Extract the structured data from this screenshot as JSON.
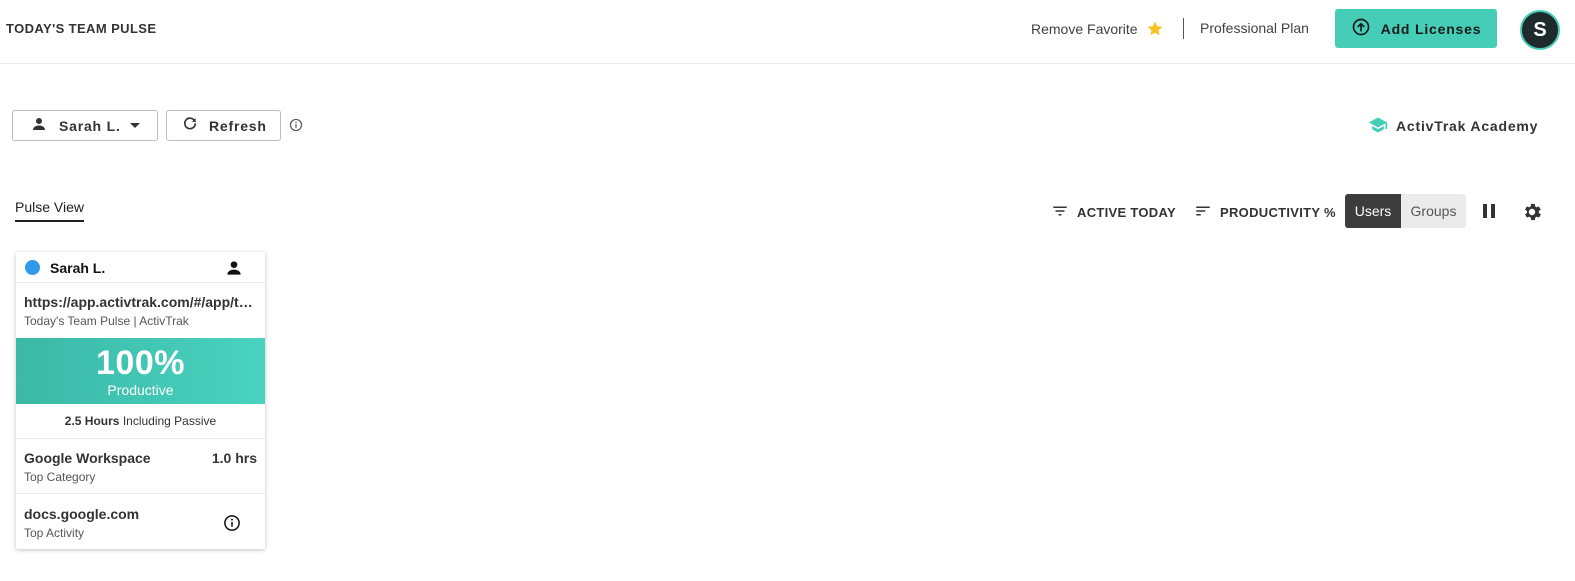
{
  "header": {
    "title": "TODAY'S TEAM PULSE",
    "favorite_label": "Remove Favorite",
    "plan_label": "Professional Plan",
    "add_licenses_label": "Add Licenses",
    "avatar_initial": "S"
  },
  "toolbar": {
    "user_select_label": "Sarah L.",
    "refresh_label": "Refresh",
    "academy_label": "ActivTrak Academy"
  },
  "view": {
    "tab_label": "Pulse View",
    "filter_label": "ACTIVE TODAY",
    "sort_label": "PRODUCTIVITY %",
    "toggle_users": "Users",
    "toggle_groups": "Groups"
  },
  "card": {
    "user_name": "Sarah L.",
    "status_color": "#2f9bea",
    "current_url": "https://app.activtrak.com/#/app/teampulse",
    "current_title": "Today's Team Pulse | ActivTrak",
    "productivity_pct": "100%",
    "productivity_label": "Productive",
    "hours_value": "2.5 Hours",
    "hours_suffix": "Including Passive",
    "top_category_name": "Google Workspace",
    "top_category_hours": "1.0 hrs",
    "top_category_label": "Top Category",
    "top_activity_name": "docs.google.com",
    "top_activity_label": "Top Activity"
  },
  "colors": {
    "accent": "#46cdb7",
    "productive_band": "#42c7b4",
    "toggle_active": "#3c3c3c",
    "favorite_star": "#f6c21c"
  },
  "icons": [
    "star-icon",
    "upload-circle-icon",
    "person-icon",
    "refresh-icon",
    "info-icon",
    "graduation-cap-icon",
    "filter-icon",
    "sort-icon",
    "pause-icon",
    "gear-icon"
  ]
}
